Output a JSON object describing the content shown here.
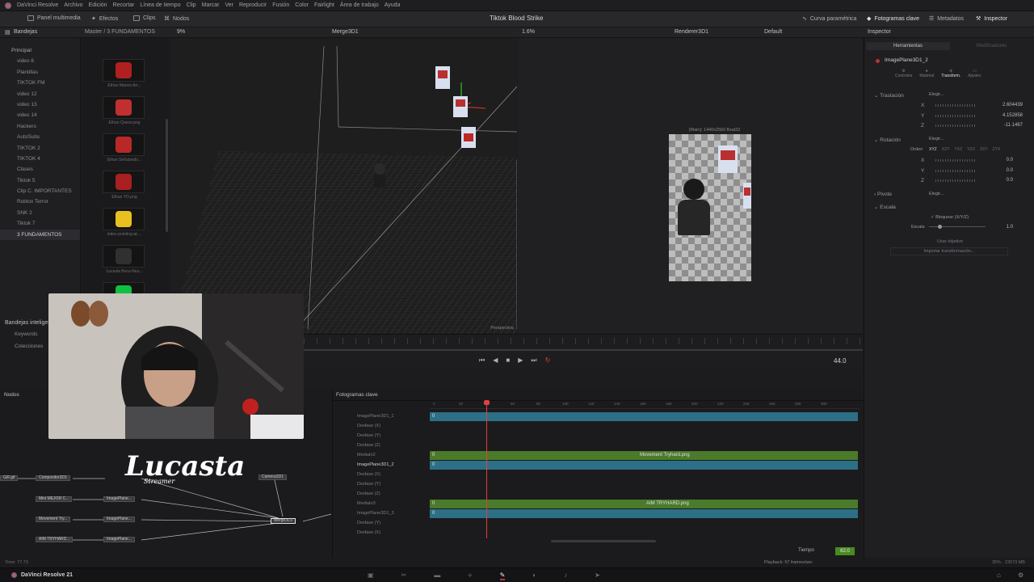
{
  "menu": [
    "DaVinci Resolve",
    "Archivo",
    "Edición",
    "Recortar",
    "Línea de tiempo",
    "Clip",
    "Marcar",
    "Ver",
    "Reproducir",
    "Fusión",
    "Color",
    "Fairlight",
    "Área de trabajo",
    "Ayuda"
  ],
  "toolbar": {
    "media_pool": "Panel multimedia",
    "effects": "Efectos",
    "clips": "Clips",
    "nodes": "Nodos",
    "project_title": "Tiktok Blood Strike",
    "spline": "Curva paramétrica",
    "keyframes": "Fotogramas clave",
    "metadata": "Metadatos",
    "inspector": "Inspector"
  },
  "subbar": {
    "bins": "Bandejas",
    "breadcrumb": "Master / 3 FUNDAMENTOS",
    "zoom_left": "9%",
    "viewer_left": "Merge3D1",
    "zoom_mid": "1.6%",
    "viewer_right": "Renderer3D1",
    "default": "Default",
    "inspector": "Inspector"
  },
  "bins": {
    "root": "Principal",
    "items": [
      "video 6",
      "Plantillas",
      "TIKTOK FM",
      "video 12",
      "video 13",
      "video 14",
      "Hackers",
      "AutoSubs",
      "TIKTOK 2",
      "TIKTOK 4",
      "Clases",
      "Tiktok 5",
      "Clip C. IMPORTANTES",
      "Roblox Terror",
      "SNK 2",
      "Tiktok 7",
      "3 FUNDAMENTOS"
    ],
    "selected_index": 16,
    "smart_bins": "Bandejas inteligentes",
    "keywords": "Keywords",
    "collections": "Colecciones"
  },
  "clips": [
    {
      "label": "Ethan Manos Arr...",
      "color": "#b02020"
    },
    {
      "label": "Ethan Queso.png",
      "color": "#c03030"
    },
    {
      "label": "Ethan Señalando...",
      "color": "#b82828"
    },
    {
      "label": "Ethan YO.png",
      "color": "#a82020"
    },
    {
      "label": "index-pointing-at-...",
      "color": "#e8c020"
    },
    {
      "label": "Lucasta Boca Neu...",
      "color": "#303030"
    },
    {
      "label": "",
      "color": "#10c040"
    }
  ],
  "viewer3d": {
    "label": "Perspectiva"
  },
  "viewer2d": {
    "info": "[Main]: 1440x2560 float32"
  },
  "inspector": {
    "tab_tools": "Herramientas",
    "tab_modifiers": "Modificadores",
    "node_name": "ImagePlane3D1_2",
    "subtabs": [
      "Controles",
      "Material",
      "Transform.",
      "Ajustes"
    ],
    "active_subtab": 2,
    "translation": "Traslación",
    "pick": "Elegir...",
    "tx": "2.604439",
    "ty": "4.152858",
    "tz": "-11.1467",
    "rotation": "Rotación",
    "order": "Orden",
    "orders": [
      "XYZ",
      "XZY",
      "YXZ",
      "YZX",
      "ZXY",
      "ZYX"
    ],
    "rx": "0.0",
    "ry": "0.0",
    "rz": "0.0",
    "pivot": "Pivote",
    "scale": "Escala",
    "lock": "Bloquear (X/Y/Z)",
    "scale_lbl": "Escala",
    "scale_val": "1.0",
    "use_target": "Usar objetivo",
    "import_transform": "Importar transformación..."
  },
  "transport": {
    "frame": "44.0"
  },
  "nodes_panel": {
    "title": "Nodos",
    "nodes": [
      "Compositor3D1",
      "Camera3D1",
      "Mini MEJOR C...",
      "Movement Try...",
      "AIM TRYHARD...",
      "ImagePlane...",
      "ImagePlane...",
      "ImagePlane...",
      "Merge3D1",
      "GIF.gif"
    ],
    "watermark": "Lucasta",
    "watermark_sub": "Streamer"
  },
  "keyframes_panel": {
    "title": "Fotogramas clave",
    "rows": [
      "ImagePlane3D1_1",
      "Desfase (X)",
      "Desfase (Y)",
      "Desfase (Z)",
      "MediaIn2",
      "ImagePlane3D1_2",
      "Desfase (X)",
      "Desfase (Y)",
      "Desfase (Z)",
      "MediaIn3",
      "ImagePlane3D1_3",
      "Desfase (Y)",
      "Desfase (X)"
    ],
    "clip1": "Movement Tryhard.png",
    "clip2": "AIM TRYHARD.png",
    "time_label": "Tiempo",
    "time_value": "62.0",
    "zero": "0",
    "ruler": [
      "0",
      "20",
      "40",
      "60",
      "80",
      "100",
      "120",
      "140",
      "160",
      "180",
      "200",
      "220",
      "240",
      "260",
      "280",
      "300"
    ]
  },
  "status": {
    "time": "Time: 77.73",
    "playback": "Playback: 57 frames/sec",
    "mem": "35% · 23073 MB"
  },
  "app": {
    "name": "DaVinci Resolve 21"
  }
}
